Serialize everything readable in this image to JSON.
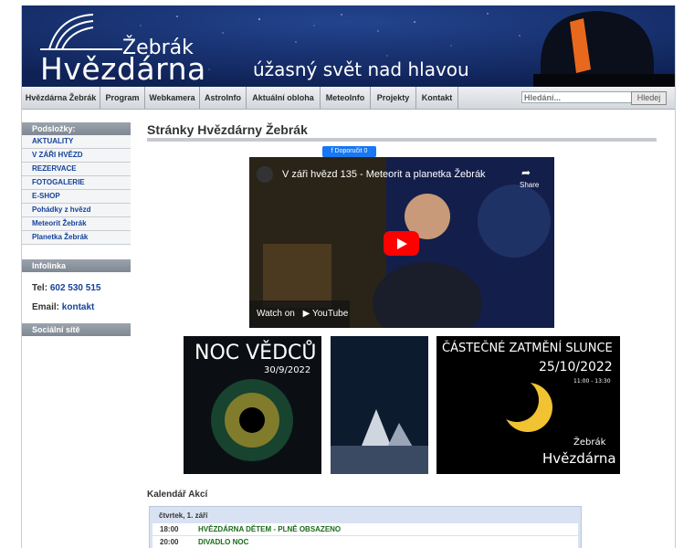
{
  "header": {
    "logo_top": "Žebrák",
    "logo_main": "Hvězdárna",
    "slogan": "úžasný svět nad hlavou"
  },
  "nav": {
    "items": [
      "Hvězdárna Žebrák",
      "Program",
      "Webkamera",
      "AstroInfo",
      "Aktuální obloha",
      "MeteoInfo",
      "Projekty",
      "Kontakt"
    ],
    "search_placeholder": "Hledání...",
    "search_button": "Hledej"
  },
  "sidebar": {
    "subfolders_title": "Podsložky:",
    "items": [
      "AKTUALITY",
      "V ZÁŘI HVĚZD",
      "REZERVACE",
      "FOTOGALERIE",
      "E-SHOP",
      "Pohádky z hvězd",
      "Meteorit Žebrák",
      "Planetka Žebrák"
    ],
    "infoline_title": "Infolinka",
    "tel_label": "Tel:",
    "tel_value": "602 530 515",
    "email_label": "Email:",
    "email_value": "kontakt",
    "social_title": "Sociální sítě"
  },
  "main": {
    "title": "Stránky Hvězdárny Žebrák",
    "fb_button": "Doporučit 0",
    "video_title": "V záři hvězd 135 - Meteorit a planetka Žebrák",
    "video_share": "Share",
    "video_watch": "Watch on",
    "video_brand": "YouTube"
  },
  "posters": {
    "p1_title": "NOC VĚDCŮ",
    "p1_date": "30/9/2022",
    "p3_title": "ČÁSTEČNÉ ZATMĚNÍ SLUNCE",
    "p3_date": "25/10/2022",
    "p3_time": "11:00 - 13:30",
    "p3_logo_top": "Žebrák",
    "p3_logo_main": "Hvězdárna"
  },
  "calendar": {
    "title": "Kalendář Akcí",
    "day": "čtvrtek, 1. září",
    "events": [
      {
        "time": "18:00",
        "name": "HVĚZDÁRNA DĚTEM - PLNĚ OBSAZENO"
      },
      {
        "time": "20:00",
        "name": "DIVADLO NOC"
      }
    ]
  },
  "colors": {
    "header_bg": "#16306b",
    "link_blue": "#14429a",
    "event_green": "#1a6b1a",
    "youtube_red": "#ff0000",
    "fb_blue": "#1877f2"
  }
}
